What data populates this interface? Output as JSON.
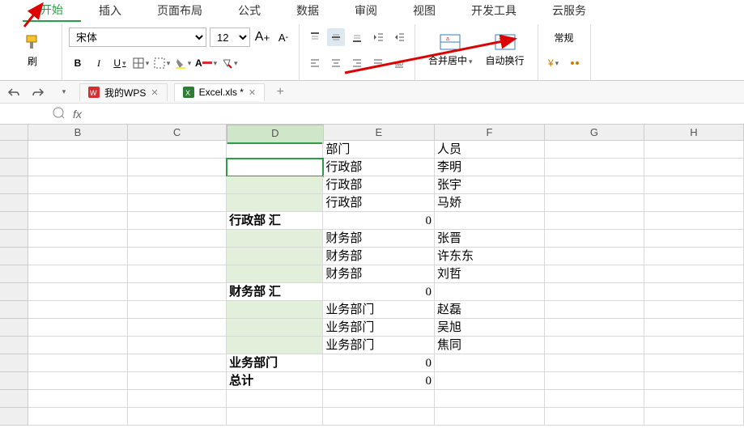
{
  "menu": {
    "tabs": [
      "开始",
      "插入",
      "页面布局",
      "公式",
      "数据",
      "审阅",
      "视图",
      "开发工具",
      "云服务"
    ],
    "active": 0
  },
  "font": {
    "name": "宋体",
    "size": "12"
  },
  "toolbar": {
    "paintfmt_suffix": "刷",
    "merge_center": "合并居中",
    "wrap_text": "自动换行",
    "style_normal": "常规"
  },
  "docs": {
    "wps": "我的WPS",
    "excel": "Excel.xls *"
  },
  "formula_prefix": "fx",
  "columns": [
    "B",
    "C",
    "D",
    "E",
    "F",
    "G",
    "H"
  ],
  "chart_data": {
    "type": "table",
    "active_column": "D",
    "rows": [
      {
        "D": "",
        "E": "部门",
        "F": "人员",
        "d_green": false,
        "d_bold": false,
        "e_align": "left"
      },
      {
        "D": "",
        "E": "行政部",
        "F": "李明",
        "d_green": true,
        "d_bold": false,
        "e_align": "left",
        "active": true
      },
      {
        "D": "",
        "E": "行政部",
        "F": "张宇",
        "d_green": true,
        "d_bold": false,
        "e_align": "left"
      },
      {
        "D": "",
        "E": "行政部",
        "F": "马娇",
        "d_green": true,
        "d_bold": false,
        "e_align": "left"
      },
      {
        "D": "行政部 汇",
        "E": "0",
        "F": "",
        "d_green": false,
        "d_bold": true,
        "e_align": "right"
      },
      {
        "D": "",
        "E": "财务部",
        "F": "张晋",
        "d_green": true,
        "d_bold": false,
        "e_align": "left"
      },
      {
        "D": "",
        "E": "财务部",
        "F": "许东东",
        "d_green": true,
        "d_bold": false,
        "e_align": "left"
      },
      {
        "D": "",
        "E": "财务部",
        "F": "刘哲",
        "d_green": true,
        "d_bold": false,
        "e_align": "left"
      },
      {
        "D": "财务部 汇",
        "E": "0",
        "F": "",
        "d_green": false,
        "d_bold": true,
        "e_align": "right"
      },
      {
        "D": "",
        "E": "业务部门",
        "F": "赵磊",
        "d_green": true,
        "d_bold": false,
        "e_align": "left"
      },
      {
        "D": "",
        "E": "业务部门",
        "F": "吴旭",
        "d_green": true,
        "d_bold": false,
        "e_align": "left"
      },
      {
        "D": "",
        "E": "业务部门",
        "F": "焦同",
        "d_green": true,
        "d_bold": false,
        "e_align": "left"
      },
      {
        "D": "业务部门",
        "E": "0",
        "F": "",
        "d_green": false,
        "d_bold": true,
        "e_align": "right"
      },
      {
        "D": "总计",
        "E": "0",
        "F": "",
        "d_green": false,
        "d_bold": true,
        "e_align": "right"
      },
      {
        "D": "",
        "E": "",
        "F": "",
        "d_green": false,
        "d_bold": false,
        "e_align": "left"
      },
      {
        "D": "",
        "E": "",
        "F": "",
        "d_green": false,
        "d_bold": false,
        "e_align": "left"
      }
    ]
  }
}
